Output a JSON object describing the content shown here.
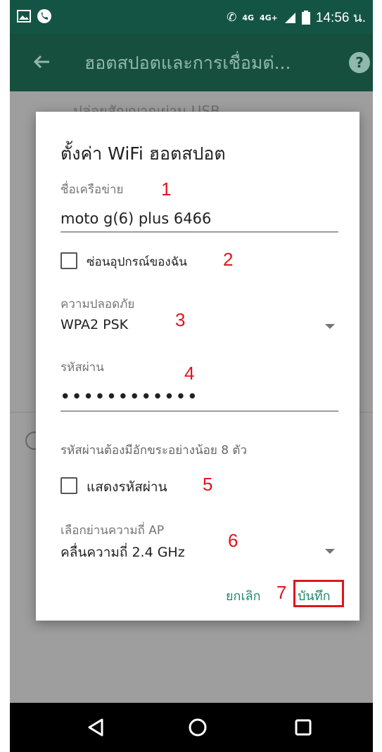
{
  "statusbar": {
    "network_small": "4G",
    "network": "4G+",
    "time": "14:56 น."
  },
  "toolbar": {
    "title": "ฮอตสปอตและการเชื่อมต่...",
    "help_label": "?"
  },
  "background": {
    "item_text": "ปล่อยสัญญาณผ่าน USB"
  },
  "dialog": {
    "title": "ตั้งค่า WiFi ฮอตสปอต",
    "network_name_label": "ชื่อเครือข่าย",
    "network_name_value": "moto g(6) plus 6466",
    "hide_device_label": "ซ่อนอุปกรณ์ของฉัน",
    "security_label": "ความปลอดภัย",
    "security_value": "WPA2 PSK",
    "password_label": "รหัสผ่าน",
    "password_value": "••••••••••••",
    "password_hint": "รหัสผ่านต้องมีอักขระอย่างน้อย 8 ตัว",
    "show_password_label": "แสดงรหัสผ่าน",
    "band_label": "เลือกย่านความถี่ AP",
    "band_value": "คลื่นความถี่ 2.4 GHz",
    "cancel_label": "ยกเลิก",
    "save_label": "บันทึก"
  },
  "annotations": [
    "1",
    "2",
    "3",
    "4",
    "5",
    "6",
    "7"
  ],
  "colors": {
    "accent": "#1b8a6c",
    "annotation": "#e0151c",
    "toolbar": "#174f3f"
  }
}
